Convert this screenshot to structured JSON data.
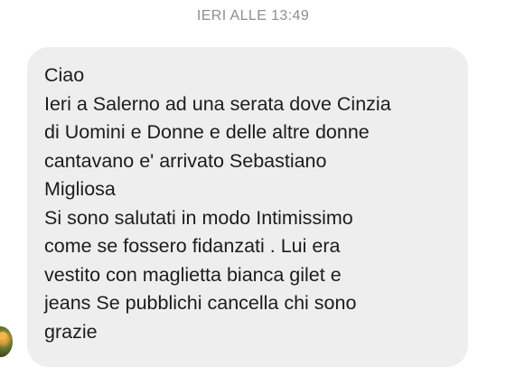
{
  "header": {
    "timestamp": "IERI ALLE 13:49"
  },
  "message": {
    "lines": [
      "Ciao",
      "Ieri a Salerno ad una serata dove Cinzia",
      "di Uomini e Donne e delle altre donne",
      "cantavano e' arrivato Sebastiano",
      "Migliosa",
      "Si sono salutati in modo Intimissimo",
      "come se fossero fidanzati . Lui era",
      "vestito con maglietta bianca gilet e",
      "jeans Se pubblichi cancella chi sono",
      "grazie"
    ]
  },
  "colors": {
    "bubble_background": "#eeeeef",
    "timestamp_text": "#8e8e93",
    "message_text": "#1c1c1e"
  }
}
